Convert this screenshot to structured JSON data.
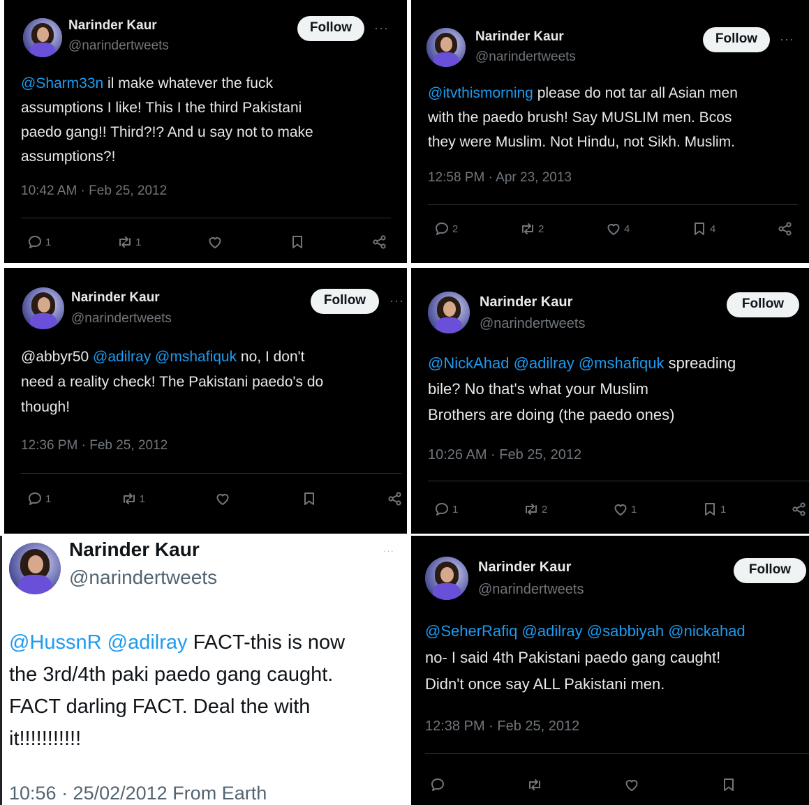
{
  "tweets": [
    {
      "name": "Narinder Kaur",
      "handle": "@narindertweets",
      "follow_label": "Follow",
      "more_label": "···",
      "mentions": "@Sharm33n",
      "text": " il make whatever the fuck\nassumptions I like! This I the third Pakistani\npaedo gang!! Third?!? And u say not to make\nassumptions?!",
      "timestamp": "10:42 AM · Feb 25, 2012",
      "replies": "1",
      "retweets": "1",
      "likes": "",
      "bookmarks": ""
    },
    {
      "name": "Narinder Kaur",
      "handle": "@narindertweets",
      "follow_label": "Follow",
      "more_label": "···",
      "mentions": "@itvthismorning",
      "text": " please do not tar all Asian men\nwith the paedo brush! Say MUSLIM men. Bcos\nthey were Muslim. Not Hindu, not Sikh. Muslim.",
      "timestamp": "12:58 PM · Apr 23, 2013",
      "replies": "2",
      "retweets": "2",
      "likes": "4",
      "bookmarks": "4"
    },
    {
      "name": "Narinder Kaur",
      "handle": "@narindertweets",
      "follow_label": "Follow",
      "more_label": "···",
      "pre_text": "@abbyr50 ",
      "mentions": "@adilray @mshafiquk",
      "text": " no, I don't\nneed a reality check! The Pakistani paedo's do\nthough!",
      "timestamp": "12:36 PM · Feb 25, 2012",
      "replies": "1",
      "retweets": "1",
      "likes": "",
      "bookmarks": ""
    },
    {
      "name": "Narinder Kaur",
      "handle": "@narindertweets",
      "follow_label": "Follow",
      "mentions": "@NickAhad @adilray @mshafiquk",
      "text": " spreading\nbile? No that's what your Muslim\nBrothers are doing (the paedo ones)",
      "timestamp": "10:26 AM · Feb 25, 2012",
      "replies": "1",
      "retweets": "2",
      "likes": "1",
      "bookmarks": "1"
    },
    {
      "name": "Narinder Kaur",
      "handle": "@narindertweets",
      "more_label": "···",
      "mentions": "@HussnR @adilray",
      "text": " FACT-this is now\nthe 3rd/4th paki paedo gang caught.\nFACT darling FACT. Deal the with\nit!!!!!!!!!!!",
      "timestamp": "10:56 · 25/02/2012 From Earth"
    },
    {
      "name": "Narinder Kaur",
      "handle": "@narindertweets",
      "follow_label": "Follow",
      "mentions": "@SeherRafiq @adilray @sabbiyah @nickahad",
      "text": "\nno- I said 4th Pakistani paedo gang caught!\nDidn't once say ALL Pakistani men.",
      "timestamp": "12:38 PM · Feb 25, 2012",
      "replies": "",
      "retweets": "",
      "likes": "",
      "bookmarks": ""
    }
  ]
}
